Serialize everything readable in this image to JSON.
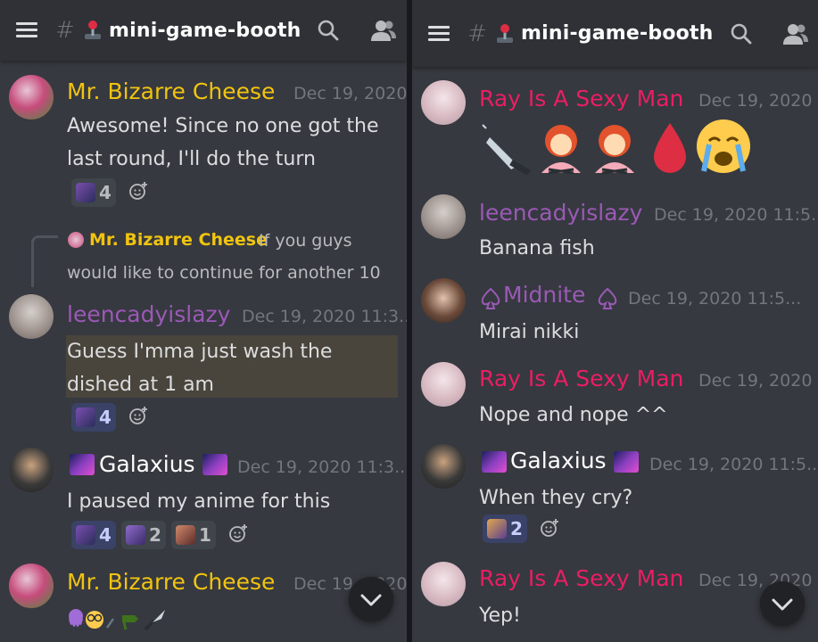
{
  "channel": {
    "name": "mini-game-booth",
    "hash": "#"
  },
  "left": {
    "messages": [
      {
        "author": "Mr. Bizarre Cheese",
        "timestamp": "Dec 19, 2020",
        "lines": [
          "Awesome! Since no one got the",
          "last round, I'll do the turn"
        ],
        "reactions": [
          {
            "count": "4"
          }
        ]
      },
      {
        "reply": {
          "author": "Mr. Bizarre Cheese",
          "text_line1": "If you guys",
          "text_line2": "would like to continue for another 10"
        },
        "author": "leencadyislazy",
        "timestamp": "Dec 19, 2020 11:3...",
        "lines": [
          "Guess I'mma just wash the",
          "dished at 1 am"
        ],
        "reactions": [
          {
            "count": "4"
          }
        ]
      },
      {
        "author": "Galaxius",
        "timestamp": "Dec 19, 2020 11:3...",
        "lines": [
          "I paused my anime for this"
        ],
        "reactions": [
          {
            "count": "4"
          },
          {
            "count": "2"
          },
          {
            "count": "1"
          }
        ]
      },
      {
        "author": "Mr. Bizarre Cheese",
        "timestamp": "Dec 19, 2020"
      }
    ]
  },
  "right": {
    "messages": [
      {
        "author": "Ray Is A Sexy Man",
        "timestamp": "Dec 19, 2020"
      },
      {
        "author": "leencadyislazy",
        "timestamp": "Dec 19, 2020 11:5...",
        "text": "Banana fish"
      },
      {
        "author": "Midnite",
        "timestamp": "Dec 19, 2020 11:5...",
        "text": "Mirai nikki"
      },
      {
        "author": "Ray Is A Sexy Man",
        "timestamp": "Dec 19, 2020",
        "text": "Nope and nope ^^"
      },
      {
        "author": "Galaxius",
        "timestamp": "Dec 19, 2020 11:5...",
        "text": "When they cry?",
        "reactions": [
          {
            "count": "2"
          }
        ]
      },
      {
        "author": "Ray Is A Sexy Man",
        "timestamp": "Dec 19, 2020",
        "text": "Yep!"
      }
    ]
  },
  "icons": {
    "menu": "hamburger-icon",
    "channel_emoji": "joystick-icon",
    "search": "search-icon",
    "members": "members-icon",
    "add_reaction": "add-reaction-icon",
    "jump": "chevron-down-icon"
  },
  "colors": {
    "background": "#36393f",
    "topbar": "#2f3136",
    "bizarre_cheese": "#f1c40f",
    "leencadyislazy": "#9b59b6",
    "midnite": "#9b59b6",
    "ray": "#e91e63",
    "galaxius": "#ffffff",
    "timestamp": "#72767d",
    "highlight": "#49443c"
  }
}
